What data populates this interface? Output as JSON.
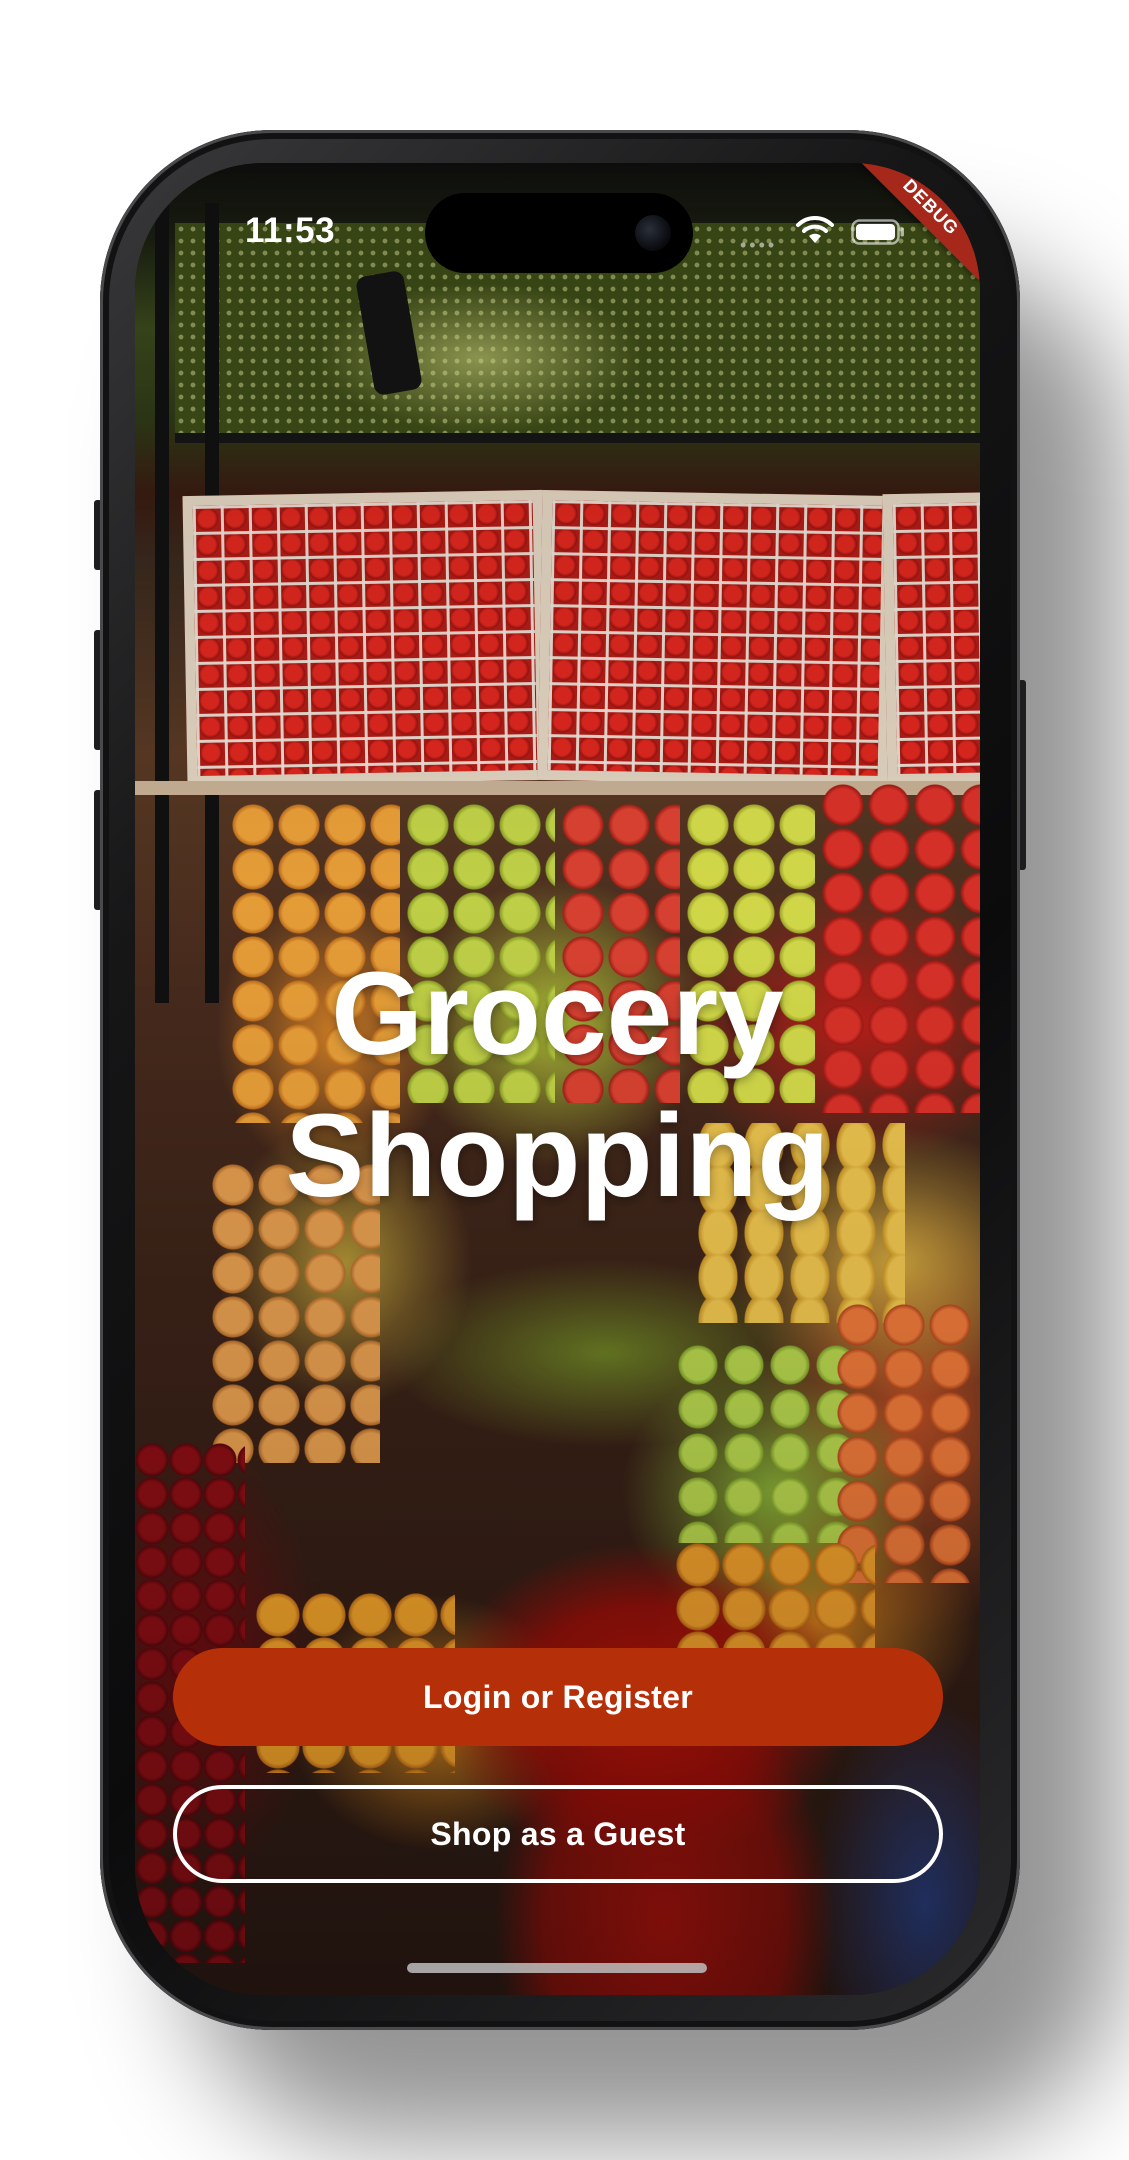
{
  "status_bar": {
    "time": "11:53",
    "signal_icon": "cellular-dots-icon",
    "wifi_icon": "wifi-icon",
    "battery_icon": "battery-icon"
  },
  "debug_banner": {
    "label": "DEBUG",
    "color": "#a5281b"
  },
  "hero": {
    "background_image": "fruit-market-stall-photo",
    "title_line1": "Grocery",
    "title_line2": "Shopping"
  },
  "actions": {
    "login_label": "Login or Register",
    "guest_label": "Shop as a Guest",
    "primary_color": "#b53009",
    "outline_color": "#ffffff"
  }
}
